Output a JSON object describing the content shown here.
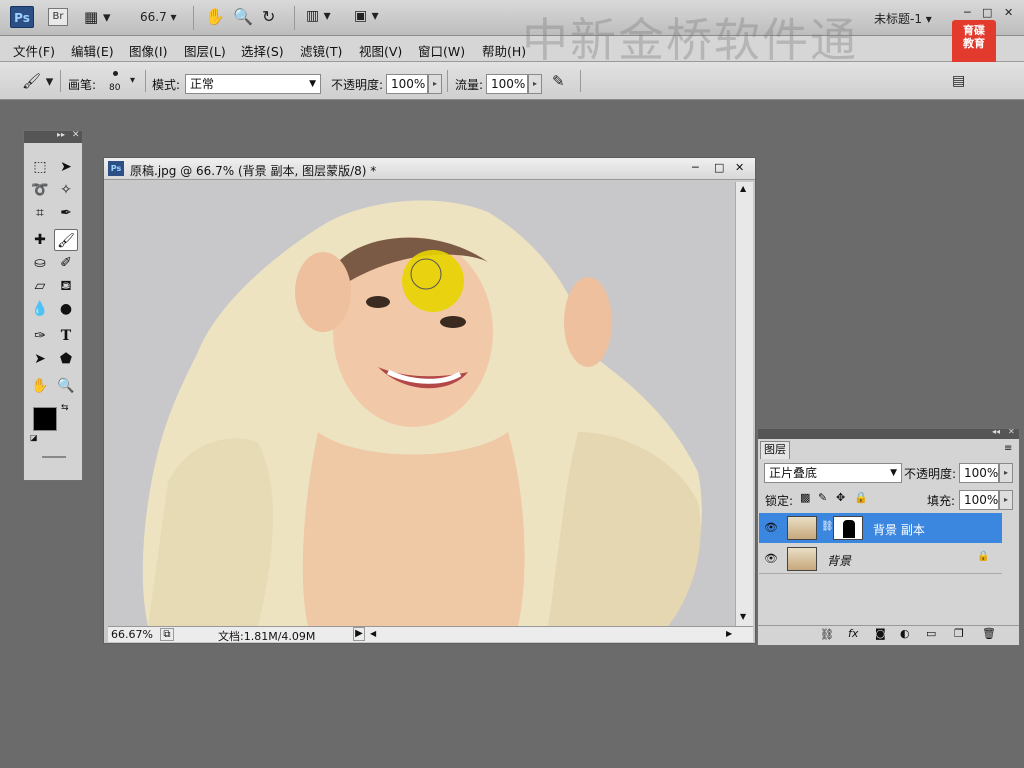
{
  "app": {
    "logo": "Ps",
    "bridge": "Br",
    "zoom": "66.7",
    "doc_title_right": "未标题-1",
    "watermark": "中新金桥软件通",
    "edu_logo_line1": "育碟",
    "edu_logo_line2": "教育",
    "win_min": "─",
    "win_max": "□",
    "win_close": "✕"
  },
  "menu": [
    "文件(F)",
    "编辑(E)",
    "图像(I)",
    "图层(L)",
    "选择(S)",
    "滤镜(T)",
    "视图(V)",
    "窗口(W)",
    "帮助(H)"
  ],
  "options": {
    "brush_label": "画笔:",
    "brush_size": "80",
    "mode_label": "模式:",
    "mode_value": "正常",
    "opacity_label": "不透明度:",
    "opacity_value": "100%",
    "flow_label": "流量:",
    "flow_value": "100%"
  },
  "document": {
    "title": "原稿.jpg @ 66.7% (背景 副本, 图层蒙版/8) *",
    "zoom_status": "66.67%",
    "doc_size": "文档:1.81M/4.09M"
  },
  "layers": {
    "tab": "图层",
    "blend_mode": "正片叠底",
    "opacity_label": "不透明度:",
    "opacity_value": "100%",
    "lock_label": "锁定:",
    "fill_label": "填充:",
    "fill_value": "100%",
    "items": [
      {
        "name": "背景 副本",
        "selected": true
      },
      {
        "name": "背景",
        "selected": false
      }
    ]
  },
  "colors": {
    "highlight": "#3b87e0",
    "brush_dab": "#e8d400"
  }
}
